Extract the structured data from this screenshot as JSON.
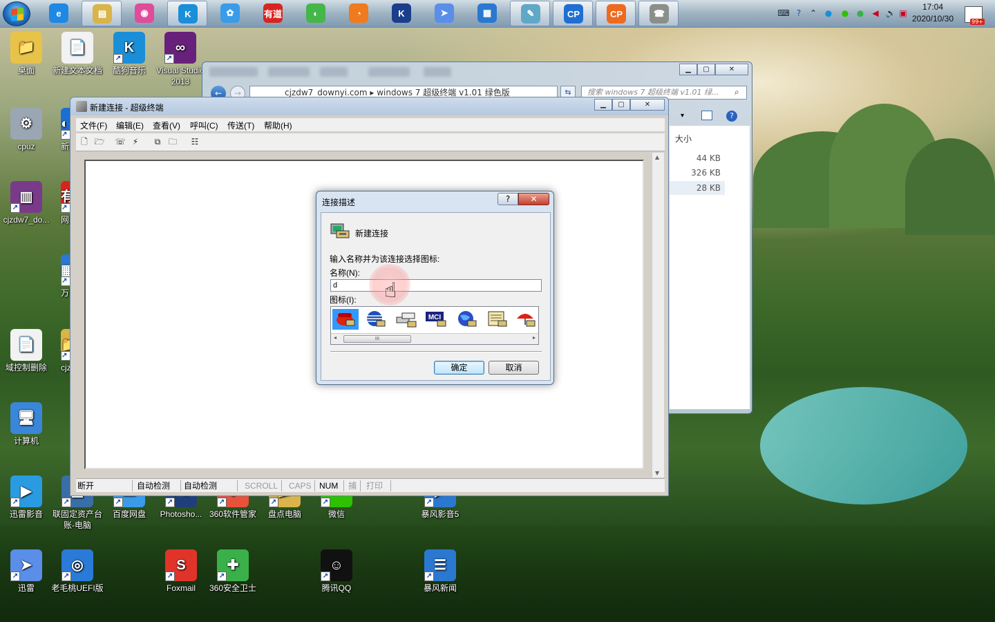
{
  "taskbar": {
    "buttons": [
      {
        "name": "ie-icon",
        "color": "#1e88e5",
        "glyph": "e"
      },
      {
        "name": "explorer-icon",
        "color": "#d9b44a",
        "glyph": "▤"
      },
      {
        "name": "browser-360-icon",
        "color": "#e04b9a",
        "glyph": "◉"
      },
      {
        "name": "kugou-icon",
        "color": "#1a8fd8",
        "glyph": "K"
      },
      {
        "name": "baidu-netdisk-icon",
        "color": "#3a9be8",
        "glyph": "✿"
      },
      {
        "name": "youdao-icon",
        "color": "#d8241f",
        "glyph": "有道"
      },
      {
        "name": "green-app-icon",
        "color": "#45b649",
        "glyph": "◐"
      },
      {
        "name": "uc-icon",
        "color": "#f07a1e",
        "glyph": "◔"
      },
      {
        "name": "kingsoft-icon",
        "color": "#1b3e8a",
        "glyph": "K"
      },
      {
        "name": "xunlei-icon",
        "color": "#5a8ee8",
        "glyph": "➤"
      },
      {
        "name": "storm-news-icon",
        "color": "#2a78d0",
        "glyph": "▦"
      },
      {
        "name": "notepad-icon",
        "color": "#5fa8c8",
        "glyph": "✎"
      },
      {
        "name": "cp-blue-icon",
        "color": "#1f6fd2",
        "glyph": "CP"
      },
      {
        "name": "cp-orange-icon",
        "color": "#ee6a1f",
        "glyph": "CP"
      },
      {
        "name": "hyperterminal-taskbar-icon",
        "color": "#8a8f8a",
        "glyph": "☎"
      }
    ],
    "clock_time": "17:04",
    "clock_date": "2020/10/30",
    "notif_badge": "99+"
  },
  "desktop": {
    "icons": [
      {
        "label": "桌面",
        "color": "#e8c34a",
        "glyph": "📁"
      },
      {
        "label": "新建文本文档",
        "color": "#f2f2f2",
        "glyph": "📄"
      },
      {
        "label": "酷狗音乐",
        "color": "#1a8fd8",
        "glyph": "K"
      },
      {
        "label": "Visual Studio 2013",
        "color": "#68217a",
        "glyph": "∞"
      },
      {
        "label": "cpuz",
        "color": "#9aa6b3",
        "glyph": "⚙"
      },
      {
        "label": "cjzdw7_do...",
        "color": "#7a3a8a",
        "glyph": "▥"
      },
      {
        "label": "域控制删除",
        "color": "#f2f2f2",
        "glyph": "📄"
      },
      {
        "label": "计算机",
        "color": "#3a86d8",
        "glyph": "🖥"
      },
      {
        "label": "迅雷影音",
        "color": "#2a9be0",
        "glyph": "▶"
      },
      {
        "label": "联固定资产台账-电脑",
        "color": "#3a6ea8",
        "glyph": "▦"
      },
      {
        "label": "百度网盘",
        "color": "#3a9be8",
        "glyph": "☁"
      },
      {
        "label": "Photosho...",
        "color": "#1f3e7a",
        "glyph": "Ps"
      },
      {
        "label": "360软件管家",
        "color": "#e8513a",
        "glyph": "✚"
      },
      {
        "label": "盘点电脑",
        "color": "#d9b44a",
        "glyph": "📁"
      },
      {
        "label": "微信",
        "color": "#2dc100",
        "glyph": "✉"
      },
      {
        "label": "暴风影音5",
        "color": "#2a78d0",
        "glyph": "▶"
      },
      {
        "label": "迅雷",
        "color": "#5a8ee8",
        "glyph": "➤"
      },
      {
        "label": "老毛桃UEFI版",
        "color": "#2a7ad8",
        "glyph": "◎"
      },
      {
        "label": "Foxmail",
        "color": "#e0342a",
        "glyph": "S"
      },
      {
        "label": "360安全卫士",
        "color": "#3ab04a",
        "glyph": "✚"
      },
      {
        "label": "腾讯QQ",
        "color": "#111111",
        "glyph": "☺"
      },
      {
        "label": "暴风新闻",
        "color": "#2a78d0",
        "glyph": "☰"
      },
      {
        "label": "新",
        "color": "#1a6fd2",
        "glyph": "◐"
      },
      {
        "label": "网易",
        "color": "#d8241f",
        "glyph": "有"
      },
      {
        "label": "万",
        "color": "#2a78d0",
        "glyph": "▦"
      },
      {
        "label": "cjzd",
        "color": "#d9b44a",
        "glyph": "📁"
      }
    ]
  },
  "explorer": {
    "address": "cjzdw7_downyi.com ▸ windows 7 超级终端 v1.01 绿色版",
    "search_placeholder": "搜索 windows 7 超级终端 v1.01 绿...",
    "column_size": "大小",
    "sizes": [
      "44 KB",
      "326 KB",
      "28 KB"
    ]
  },
  "hyperterminal": {
    "title": "新建连接 - 超级终端",
    "menu": [
      "文件(F)",
      "编辑(E)",
      "查看(V)",
      "呼叫(C)",
      "传送(T)",
      "帮助(H)"
    ],
    "status": [
      "断开",
      "自动检测",
      "自动检测",
      "SCROLL",
      "CAPS",
      "NUM",
      "捕",
      "打印"
    ]
  },
  "dialog": {
    "title": "连接描述",
    "help_label": "?",
    "close_label": "✕",
    "header": "新建连接",
    "instruction": "输入名称并为该连接选择图标:",
    "name_label": "名称(N):",
    "name_value": "d",
    "icon_label": "图标(I):",
    "icons": [
      "phone-icon",
      "globe-icon",
      "modem-icon",
      "mci-icon",
      "earth-icon",
      "document-icon",
      "umbrella-icon"
    ],
    "mci_text": "MCI",
    "ok_label": "确定",
    "cancel_label": "取消",
    "scroll_thumb": "III"
  }
}
